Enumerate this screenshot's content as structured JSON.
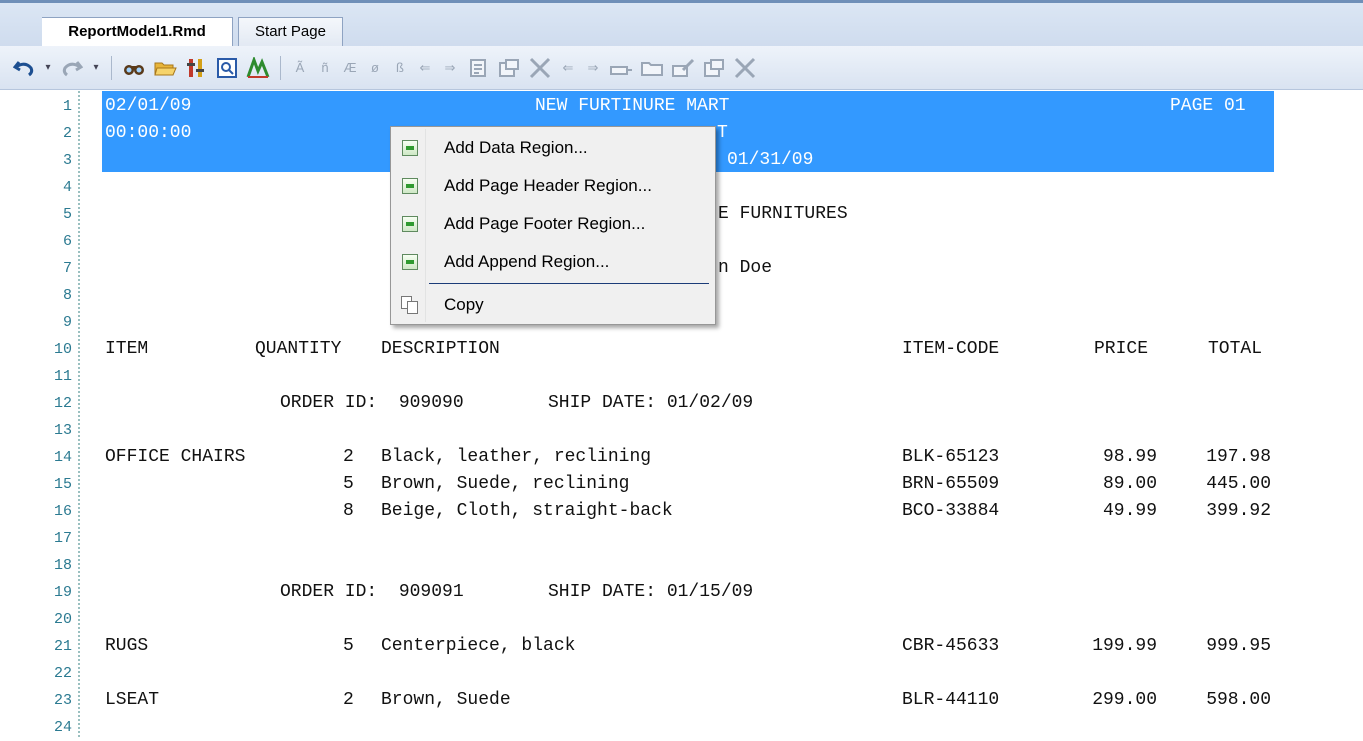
{
  "tabs": [
    {
      "label": "ReportModel1.Rmd",
      "active": true
    },
    {
      "label": "Start Page",
      "active": false
    }
  ],
  "toolbar": {
    "icons": [
      "undo-icon",
      "undo-dropdown-icon",
      "redo-icon",
      "redo-dropdown-icon",
      "find-icon",
      "open-folder-icon",
      "properties-icon",
      "preview-icon",
      "chart-icon",
      "format-a-icon",
      "format-n-icon",
      "format-italic-a-icon",
      "format-slash-o-icon",
      "format-b-icon",
      "arrow-left-icon",
      "arrow-right-icon",
      "page-icon",
      "region-icon",
      "delete-icon",
      "nav-left-icon",
      "nav-right-icon",
      "tool-icon",
      "folder-icon",
      "edit-icon",
      "region-edit-icon",
      "delete2-icon"
    ]
  },
  "editor": {
    "line_numbers": [
      "1",
      "2",
      "3",
      "4",
      "5",
      "6",
      "7",
      "8",
      "9",
      "10",
      "11",
      "12",
      "13",
      "14",
      "15",
      "16",
      "17",
      "18",
      "19",
      "20",
      "21",
      "22",
      "23",
      "24"
    ],
    "lines": {
      "l1": {
        "date": "02/01/09",
        "store": "NEW FURTINURE MART",
        "page": "PAGE 01"
      },
      "l2": {
        "time": "00:00:00",
        "frag": "T"
      },
      "l3": {
        "frag": "01/31/09"
      },
      "l5": {
        "frag": "E FURNITURES"
      },
      "l7": {
        "frag": "n Doe"
      },
      "l10": {
        "item": "ITEM",
        "quantity": "QUANTITY",
        "description": "DESCRIPTION",
        "code": "ITEM-CODE",
        "price": "PRICE",
        "total": "TOTAL"
      },
      "l12": {
        "order": "ORDER ID:  909090",
        "ship": "SHIP DATE: 01/02/09"
      },
      "rows": [
        {
          "line": 14,
          "item": "OFFICE CHAIRS",
          "qty": "2",
          "desc": "Black, leather, reclining",
          "code": "BLK-65123",
          "price": "98.99",
          "total": "197.98"
        },
        {
          "line": 15,
          "item": "",
          "qty": "5",
          "desc": "Brown, Suede, reclining",
          "code": "BRN-65509",
          "price": "89.00",
          "total": "445.00"
        },
        {
          "line": 16,
          "item": "",
          "qty": "8",
          "desc": "Beige, Cloth, straight-back",
          "code": "BCO-33884",
          "price": "49.99",
          "total": "399.92"
        },
        {
          "line": 21,
          "item": "RUGS",
          "qty": "5",
          "desc": "Centerpiece, black",
          "code": "CBR-45633",
          "price": "199.99",
          "total": "999.95"
        },
        {
          "line": 23,
          "item": "LSEAT",
          "qty": "2",
          "desc": "Brown, Suede",
          "code": "BLR-44110",
          "price": "299.00",
          "total": "598.00"
        }
      ],
      "l19": {
        "order": "ORDER ID:  909091",
        "ship": "SHIP DATE: 01/15/09"
      }
    }
  },
  "context_menu": {
    "items": [
      {
        "label": "Add Data Region...",
        "icon": "add-region-icon"
      },
      {
        "label": "Add Page Header Region...",
        "icon": "add-region-icon"
      },
      {
        "label": "Add Page Footer Region...",
        "icon": "add-region-icon"
      },
      {
        "label": "Add Append Region...",
        "icon": "add-region-icon"
      },
      {
        "label": "Copy",
        "icon": "copy-icon"
      }
    ]
  },
  "colors": {
    "selection": "#3399ff",
    "line_number": "#2b7a91",
    "tab_border": "#8ea3c2"
  }
}
